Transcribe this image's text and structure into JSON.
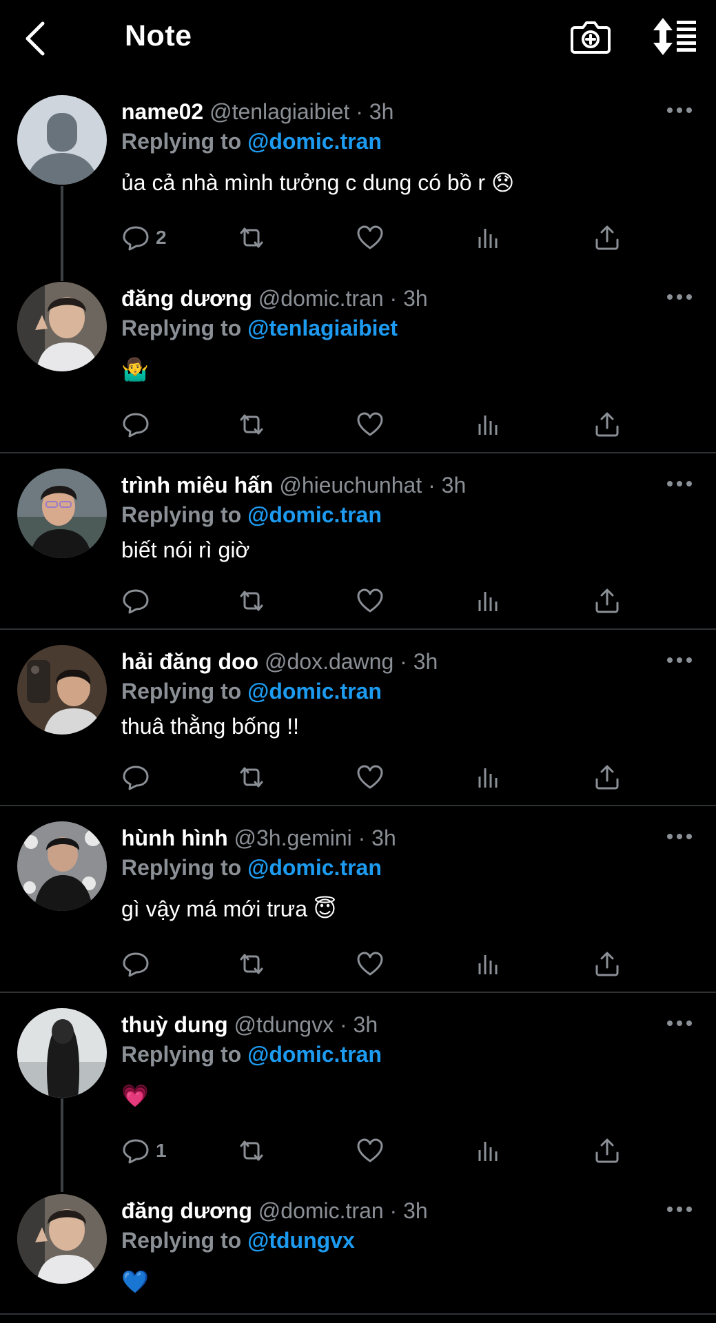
{
  "header": {
    "title": "Note",
    "icons": [
      "chevron-left-icon",
      "camera-plus-icon",
      "sort-icon"
    ]
  },
  "colors": {
    "background": "#000000",
    "accent": "#1d9bf0",
    "muted": "#8b9096",
    "divider": "#2f3336"
  },
  "posts": [
    {
      "name": "name02",
      "handle": "@tenlagiaibiet",
      "dot": "·",
      "time": "3h",
      "reply_prefix": "Replying to",
      "reply_to": "@domic.tran",
      "text": "ủa cả nhà mình tưởng c dung có bồ r 😞",
      "reply_count": "2"
    },
    {
      "name": "đăng dương",
      "handle": "@domic.tran",
      "dot": "·",
      "time": "3h",
      "reply_prefix": "Replying to",
      "reply_to": "@tenlagiaibiet",
      "text": "🤷‍♂️",
      "reply_count": ""
    },
    {
      "name": "trình miêu hấn",
      "handle": "@hieuchunhat",
      "dot": "·",
      "time": "3h",
      "reply_prefix": "Replying to",
      "reply_to": "@domic.tran",
      "text": "biết nói rì giờ",
      "reply_count": ""
    },
    {
      "name": "hải đăng doo",
      "handle": "@dox.dawng",
      "dot": "·",
      "time": "3h",
      "reply_prefix": "Replying to",
      "reply_to": "@domic.tran",
      "text": "thuâ thằng bống !!",
      "reply_count": ""
    },
    {
      "name": "hùnh hình",
      "handle": "@3h.gemini",
      "dot": "·",
      "time": "3h",
      "reply_prefix": "Replying to",
      "reply_to": "@domic.tran",
      "text": "gì vậy má mới trưa 😇",
      "reply_count": ""
    },
    {
      "name": "thuỳ dung",
      "handle": "@tdungvx",
      "dot": "·",
      "time": "3h",
      "reply_prefix": "Replying to",
      "reply_to": "@domic.tran",
      "text": "💗",
      "reply_count": "1"
    },
    {
      "name": "đăng dương",
      "handle": "@domic.tran",
      "dot": "·",
      "time": "3h",
      "reply_prefix": "Replying to",
      "reply_to": "@tdungvx",
      "text": "💙",
      "reply_count": ""
    }
  ]
}
